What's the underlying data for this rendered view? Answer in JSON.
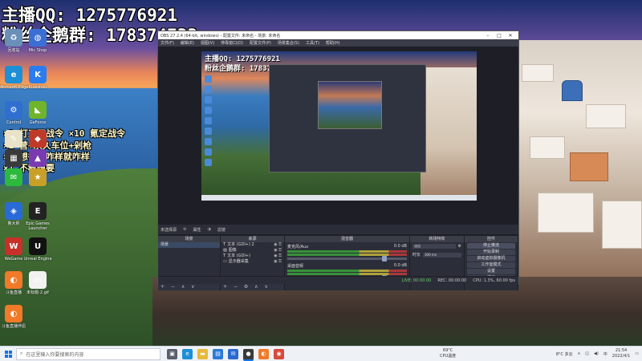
{
  "overlay": {
    "line1": "主播QQ: 1275776921",
    "line2": "粉丝企鹅群: 178374733",
    "gifts": [
      "×1  打三天战令  ×10  氪定战令",
      "×1  营+永久车位+剁枪",
      "×1  想往后咋样就咋样",
      "×1  不教想要"
    ]
  },
  "desktop_icons": [
    {
      "label": "回收站",
      "icon": "recycle-bin-icon",
      "color": "#6a8fb8",
      "glyph": "♻"
    },
    {
      "label": "Mic Shop",
      "icon": "mic-shop-icon",
      "color": "#3b6fd4",
      "glyph": "◍"
    },
    {
      "label": "Microsoft Edge",
      "icon": "edge-icon",
      "color": "#1c8fd6",
      "glyph": "e"
    },
    {
      "label": "Kuaishou",
      "icon": "kuaishou-icon",
      "color": "#2a7df0",
      "glyph": "K"
    },
    {
      "label": "Control",
      "icon": "control-panel-icon",
      "color": "#2f6fd0",
      "glyph": "⚙"
    },
    {
      "label": "GeForce",
      "icon": "geforce-icon",
      "color": "#6fb42a",
      "glyph": "◣"
    },
    {
      "label": "",
      "icon": "notepad-icon",
      "color": "#e8e2c8",
      "glyph": "✎"
    },
    {
      "label": "",
      "icon": "game-icon",
      "color": "#c03a2a",
      "glyph": "◆"
    },
    {
      "label": "",
      "icon": "app-icon",
      "color": "#3a3a3a",
      "glyph": "▦"
    },
    {
      "label": "",
      "icon": "app2-icon",
      "color": "#7a3ab0",
      "glyph": "▲"
    },
    {
      "label": "",
      "icon": "wechat-icon",
      "color": "#2dba3c",
      "glyph": "✉"
    },
    {
      "label": "",
      "icon": "game2-icon",
      "color": "#c8a028",
      "glyph": "★"
    },
    {
      "label": "鲁大师",
      "icon": "master-lu-icon",
      "color": "#2a6ad8",
      "glyph": "◈"
    },
    {
      "label": "Epic Games Launcher",
      "icon": "epic-icon",
      "color": "#222222",
      "glyph": "E"
    },
    {
      "label": "WeGame",
      "icon": "wegame-icon",
      "color": "#c8302a",
      "glyph": "W"
    },
    {
      "label": "Unreal Engine",
      "icon": "unreal-icon",
      "color": "#111111",
      "glyph": "U"
    },
    {
      "label": "斗鱼直播",
      "icon": "douyu-icon",
      "color": "#f07a28",
      "glyph": "◐"
    },
    {
      "label": "未标题-2.gif",
      "icon": "gif-file-icon",
      "color": "#f2f2f2",
      "glyph": "▭"
    },
    {
      "label": "斗鱼直播伴侣",
      "icon": "douyu-companion-icon",
      "color": "#f07a28",
      "glyph": "◐"
    }
  ],
  "obs": {
    "title": "OBS 27.2.4 (64-bit, windows) - 配置文件: 未命名 - 场景: 未命名",
    "menu": [
      "文件(F)",
      "编辑(E)",
      "视图(V)",
      "停靠窗口(D)",
      "配置文件(P)",
      "场景集合(S)",
      "工具(T)",
      "帮助(H)"
    ],
    "source_bar": {
      "no_source": "未选择源",
      "properties": "属性",
      "filters": "滤镜"
    },
    "scenes_header": "场景",
    "scenes": [
      "场景"
    ],
    "sources_header": "来源",
    "sources": [
      "文本 (GDI+) 2",
      "图像",
      "文本 (GDI+)",
      "显示器采集"
    ],
    "mixer_header": "混音器",
    "mixer": [
      {
        "name": "麦克风/Aux",
        "db": "0.0 dB"
      },
      {
        "name": "桌面音频",
        "db": "0.0 dB"
      }
    ],
    "transitions_header": "转场特效",
    "transition_type": "淡出",
    "duration_label": "时长",
    "duration_value": "300 ms",
    "controls_header": "控件",
    "controls": [
      "停止推流",
      "开始录制",
      "启动虚拟摄像机",
      "工作室模式",
      "设置",
      "退出"
    ],
    "status": {
      "live": "LIVE: 00:00:00",
      "rec": "REC: 00:00:00",
      "cpu": "CPU: 1.3%, 60.00 fps"
    },
    "preview_line1": "主播QQ: 1275776921",
    "preview_line2": "粉丝企鹅群: 178374733"
  },
  "taskbar": {
    "search_placeholder": "在这里输入你要搜索的内容",
    "apps": [
      {
        "icon": "task-view-icon",
        "color": "#5a5f6e",
        "glyph": "▣"
      },
      {
        "icon": "edge-taskbar-icon",
        "color": "#1c8fd6",
        "glyph": "e"
      },
      {
        "icon": "file-explorer-icon",
        "color": "#e8b93a",
        "glyph": "▬"
      },
      {
        "icon": "store-icon",
        "color": "#2a7ad8",
        "glyph": "▤"
      },
      {
        "icon": "mail-icon",
        "color": "#2a6ad0",
        "glyph": "✉"
      },
      {
        "icon": "obs-taskbar-icon",
        "color": "#3a3a3a",
        "glyph": "●"
      },
      {
        "icon": "douyu-taskbar-icon",
        "color": "#f07a28",
        "glyph": "◐"
      },
      {
        "icon": "chrome-icon",
        "color": "#d84a3a",
        "glyph": "◉"
      }
    ],
    "weather_temp": "69°C",
    "weather_label": "CPU温度",
    "tray_temp": "8°C 多云",
    "ime": "中",
    "time": "21:54",
    "date": "2022/4/1"
  }
}
